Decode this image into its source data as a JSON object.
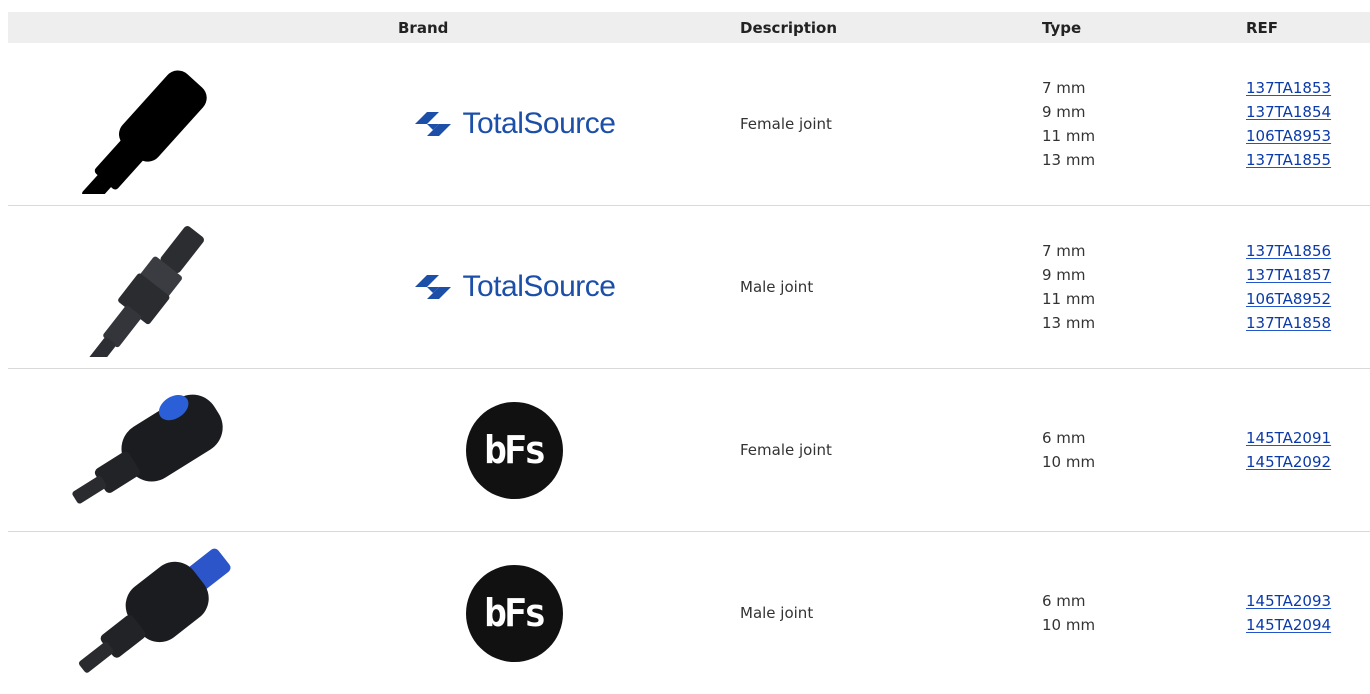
{
  "headers": {
    "brand": "Brand",
    "description": "Description",
    "type": "Type",
    "ref": "REF"
  },
  "brands": {
    "totalsource": "TotalSource",
    "bfs": "bFs"
  },
  "rows": [
    {
      "brand": "TotalSource",
      "description": "Female joint",
      "types": [
        "7 mm",
        "9 mm",
        "11 mm",
        "13 mm"
      ],
      "refs": [
        "137TA1853",
        "137TA1854",
        "106TA8953",
        "137TA1855"
      ]
    },
    {
      "brand": "TotalSource",
      "description": "Male joint",
      "types": [
        "7 mm",
        "9 mm",
        "11 mm",
        "13 mm"
      ],
      "refs": [
        "137TA1856",
        "137TA1857",
        "106TA8952",
        "137TA1858"
      ]
    },
    {
      "brand": "bFs",
      "description": "Female joint",
      "types": [
        "6 mm",
        "10 mm"
      ],
      "refs": [
        "145TA2091",
        "145TA2092"
      ]
    },
    {
      "brand": "bFs",
      "description": "Male joint",
      "types": [
        "6 mm",
        "10 mm"
      ],
      "refs": [
        "145TA2093",
        "145TA2094"
      ]
    }
  ],
  "colors": {
    "brand_blue": "#1c4fa8",
    "link": "#0b3aa8",
    "header_bg": "#eeeeee"
  }
}
